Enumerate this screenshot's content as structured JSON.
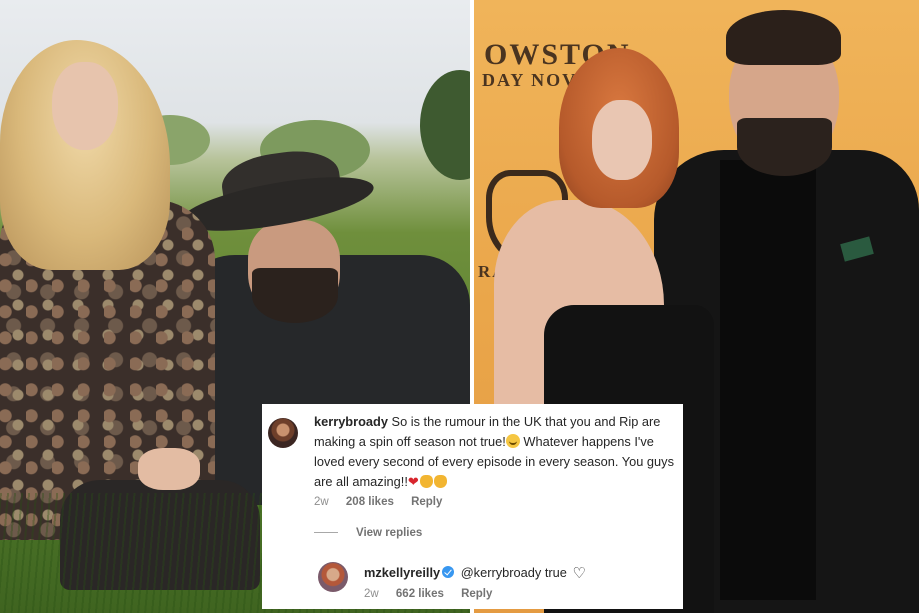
{
  "photos": {
    "left_alt": "",
    "right_backdrop_line1": "OWSTON",
    "right_backdrop_line2": "DAY NOV",
    "right_backdrop_line3": "RAM"
  },
  "comment": {
    "username": "kerrybroady",
    "text_part1": "So is the rumour in the UK that you and Rip are making a spin off season not true!",
    "text_part2": " Whatever happens I've loved every second of every episode in every season. You guys are all amazing!!",
    "time": "2w",
    "likes": "208 likes",
    "reply_label": "Reply",
    "emoji_after_part1": "crying-face-emoji",
    "emoji_end": [
      "red-heart-emoji",
      "clapping-hands-emoji",
      "clapping-hands-emoji"
    ]
  },
  "view_replies": "View replies",
  "reply": {
    "username": "mzkellyreilly",
    "verified": true,
    "mention": "@kerrybroady",
    "text": "true",
    "time": "2w",
    "likes": "662 likes",
    "reply_label": "Reply"
  },
  "colors": {
    "text": "#262626",
    "muted": "#8e8e8e",
    "verified": "#3897f0",
    "heart": "#d8252d"
  }
}
